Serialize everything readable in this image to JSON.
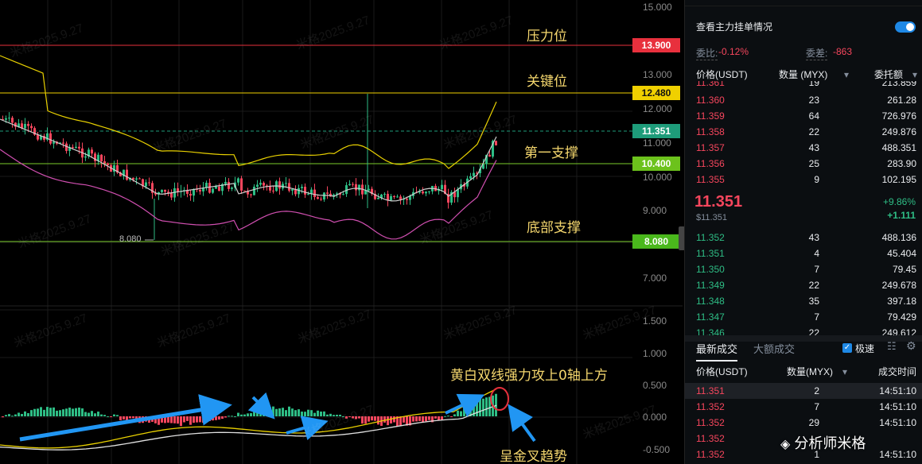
{
  "chart": {
    "y_ticks": [
      "15.000",
      "13.000",
      "12.000",
      "11.000",
      "10.000",
      "9.000",
      "7.000",
      "1.500",
      "1.000",
      "0.500",
      "0.000",
      "-0.500"
    ],
    "price_tags": {
      "resistance": {
        "value": "13.900",
        "color": "#e8303d"
      },
      "key_level": {
        "value": "12.480",
        "color": "#f0d000"
      },
      "current": {
        "value": "11.351",
        "color": "#1e9c7a"
      },
      "first_support": {
        "value": "10.400",
        "color": "#6cc21c"
      },
      "bottom_support": {
        "value": "8.080",
        "color": "#4ab81c"
      }
    },
    "low_label": "8.080",
    "annotations": {
      "resistance": "压力位",
      "key_level": "关键位",
      "first_support": "第一支撑",
      "bottom_support": "底部支撑",
      "macd_note": "黄白双线强力攻上0轴上方",
      "golden_cross": "呈金叉趋势"
    },
    "watermark": "米格2025.9.27"
  },
  "order_book": {
    "toggle_label": "查看主力挂单情况",
    "ratio_label": "委比:",
    "ratio_value": "-0.12%",
    "diff_label": "委差:",
    "diff_value": "-863",
    "headers": {
      "price": "价格(USDT)",
      "qty": "数量 (MYX)",
      "amount": "委托额"
    },
    "top_partial": {
      "price": "11.361",
      "qty": "19",
      "amount": "213.859"
    },
    "asks": [
      {
        "price": "11.360",
        "qty": "23",
        "amount": "261.28"
      },
      {
        "price": "11.359",
        "qty": "64",
        "amount": "726.976"
      },
      {
        "price": "11.358",
        "qty": "22",
        "amount": "249.876"
      },
      {
        "price": "11.357",
        "qty": "43",
        "amount": "488.351"
      },
      {
        "price": "11.356",
        "qty": "25",
        "amount": "283.90"
      },
      {
        "price": "11.355",
        "qty": "9",
        "amount": "102.195"
      }
    ],
    "last_price": "11.351",
    "last_price_sub": "$11.351",
    "change_pct": "+9.86%",
    "change_abs": "+1.111",
    "bids": [
      {
        "price": "11.352",
        "qty": "43",
        "amount": "488.136"
      },
      {
        "price": "11.351",
        "qty": "4",
        "amount": "45.404"
      },
      {
        "price": "11.350",
        "qty": "7",
        "amount": "79.45"
      },
      {
        "price": "11.349",
        "qty": "22",
        "amount": "249.678"
      },
      {
        "price": "11.348",
        "qty": "35",
        "amount": "397.18"
      },
      {
        "price": "11.347",
        "qty": "7",
        "amount": "79.429"
      }
    ],
    "bottom_partial": {
      "price": "11.346",
      "qty": "22",
      "amount": "249.612"
    }
  },
  "trades": {
    "tab_latest": "最新成交",
    "tab_large": "大额成交",
    "fast_label": "极速",
    "headers": {
      "price": "价格(USDT)",
      "qty": "数量(MYX)",
      "time": "成交时间"
    },
    "rows": [
      {
        "price": "11.351",
        "qty": "2",
        "time": "14:51:10"
      },
      {
        "price": "11.352",
        "qty": "7",
        "time": "14:51:10"
      },
      {
        "price": "11.352",
        "qty": "29",
        "time": "14:51:10"
      },
      {
        "price": "11.352",
        "qty": "",
        "time": ""
      },
      {
        "price": "11.352",
        "qty": "1",
        "time": "14:51:10"
      }
    ],
    "brand": "分析师米格"
  }
}
